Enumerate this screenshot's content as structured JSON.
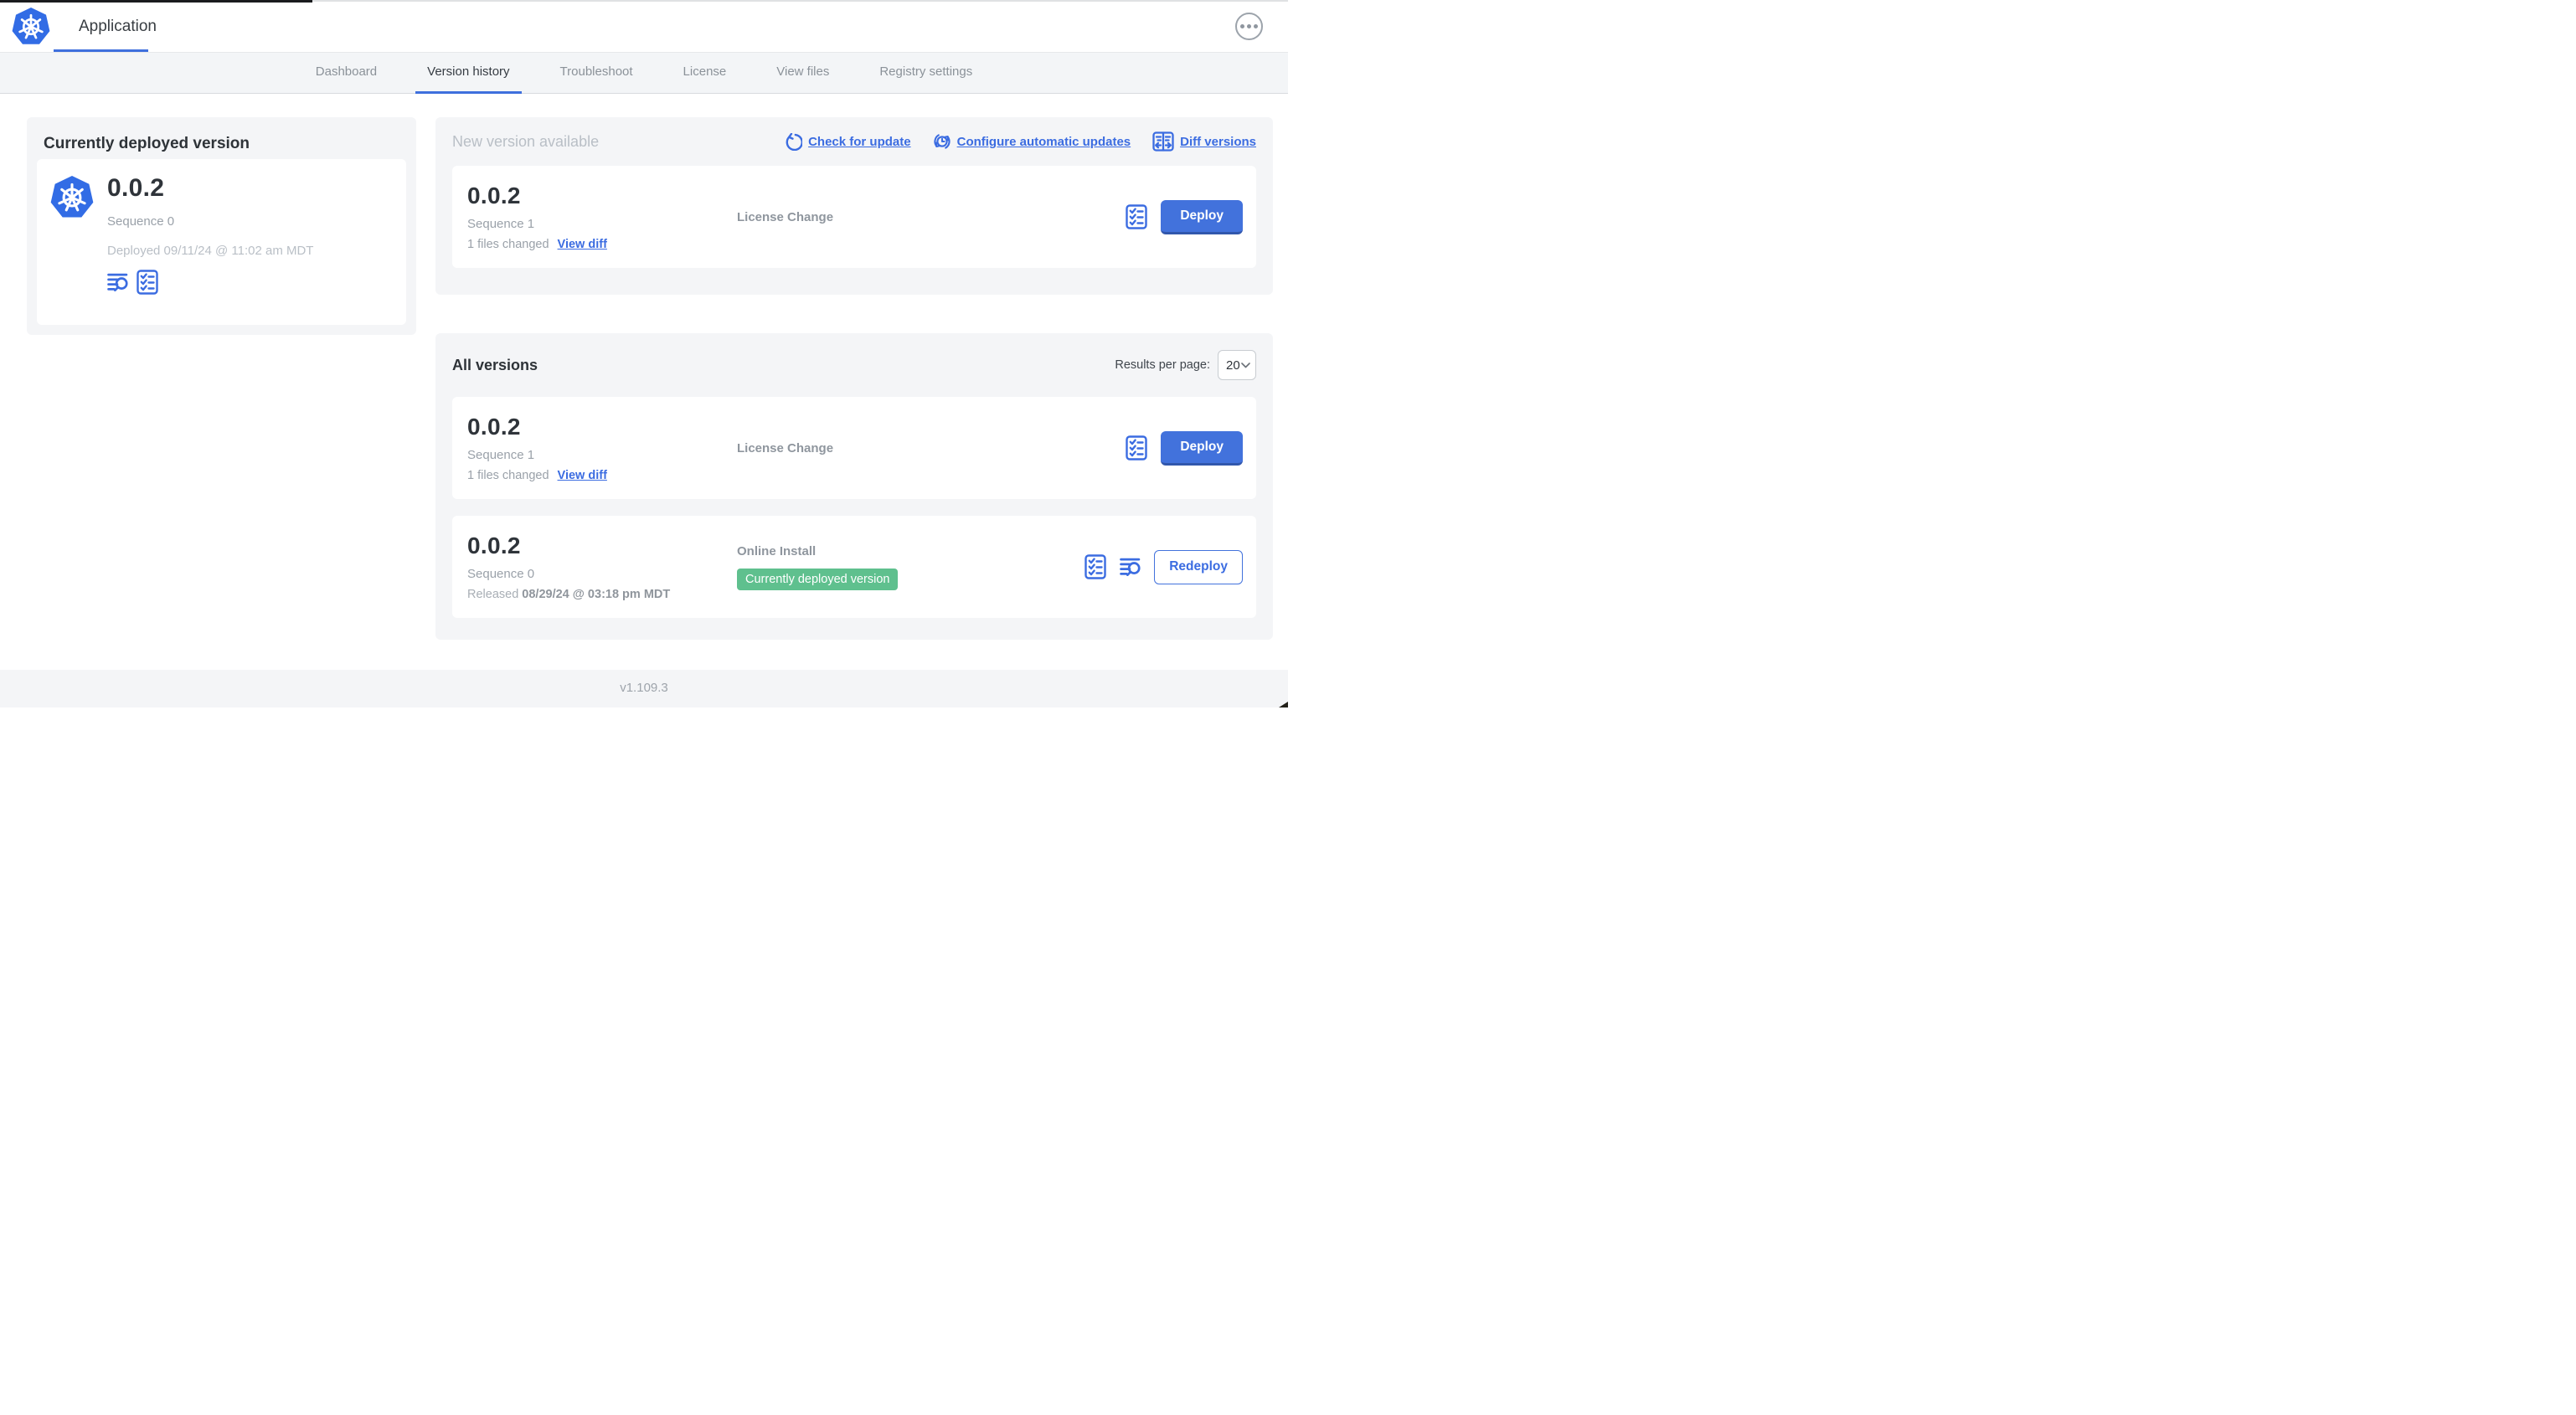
{
  "header": {
    "title": "Application",
    "more_menu_icon": "ellipsis-icon",
    "logo_icon": "kubernetes-logo"
  },
  "tabs": [
    {
      "label": "Dashboard",
      "active": false
    },
    {
      "label": "Version history",
      "active": true
    },
    {
      "label": "Troubleshoot",
      "active": false
    },
    {
      "label": "License",
      "active": false
    },
    {
      "label": "View files",
      "active": false
    },
    {
      "label": "Registry settings",
      "active": false
    }
  ],
  "currently_deployed": {
    "title": "Currently deployed version",
    "version": "0.0.2",
    "sequence": "Sequence 0",
    "deployed": "Deployed 09/11/24 @ 11:02 am MDT",
    "icons": [
      "logs-icon",
      "checklist-icon"
    ]
  },
  "new_version": {
    "title": "New version available",
    "actions": [
      {
        "label": "Check for update",
        "icon": "refresh-icon"
      },
      {
        "label": "Configure automatic updates",
        "icon": "clock-refresh-icon"
      },
      {
        "label": "Diff versions",
        "icon": "split-diff-icon"
      }
    ],
    "card": {
      "version": "0.0.2",
      "sequence": "Sequence 1",
      "files_changed": "1 files changed",
      "view_diff": "View diff",
      "source": "License Change",
      "deploy": "Deploy",
      "icon": "checklist-icon"
    }
  },
  "all_versions": {
    "title": "All versions",
    "results_per_page_label": "Results per page:",
    "results_per_page": "20",
    "rows": [
      {
        "version": "0.0.2",
        "sequence": "Sequence 1",
        "files_changed": "1 files changed",
        "view_diff": "View diff",
        "source": "License Change",
        "action": "Deploy",
        "icons": [
          "checklist-icon"
        ]
      },
      {
        "version": "0.0.2",
        "sequence": "Sequence 0",
        "released_label": "Released",
        "released_date": "08/29/24 @ 03:18 pm MDT",
        "source": "Online Install",
        "badge": "Currently deployed version",
        "action": "Redeploy",
        "icons": [
          "checklist-icon",
          "logs-icon"
        ]
      }
    ]
  },
  "footer": {
    "app_version": "v1.109.3"
  },
  "colors": {
    "primary_blue": "#3b6ce1",
    "button_blue": "#4272dc",
    "kubernetes_blue": "#326ce5",
    "badge_green": "#5fc08e",
    "panel_gray": "#f4f5f7"
  }
}
